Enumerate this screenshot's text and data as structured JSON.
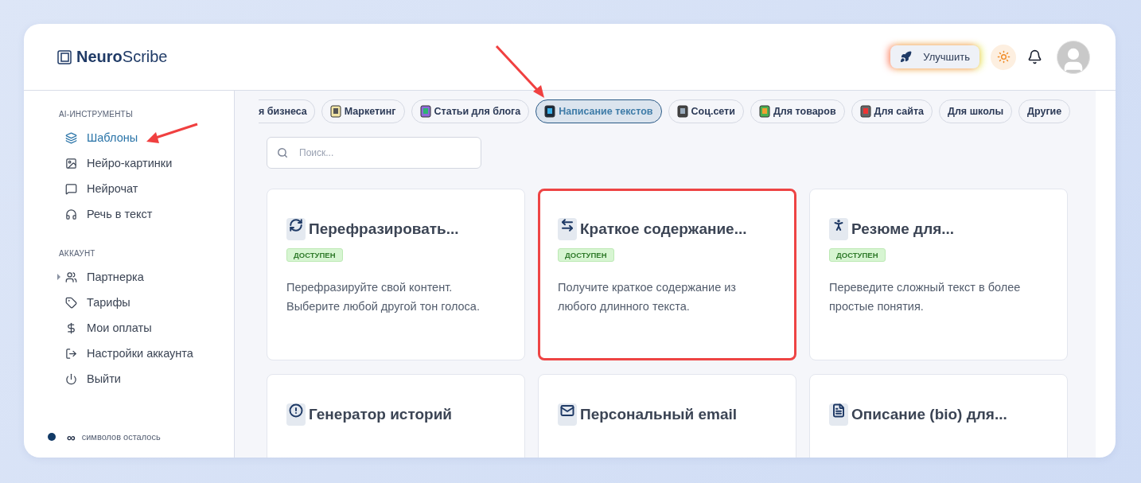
{
  "logo": {
    "text": "**Neuro**Scribe"
  },
  "header": {
    "upgrade_button": "Улучшить"
  },
  "sidebar": {
    "sections": [
      {
        "title": "AI-ИНСТРУМЕНТЫ",
        "items": [
          {
            "label": "Шаблоны",
            "selected": true
          },
          {
            "label": "Нейро-картинки",
            "selected": false
          },
          {
            "label": "Нейрочат",
            "selected": false
          },
          {
            "label": "Речь в текст",
            "selected": false
          }
        ]
      },
      {
        "title": "АККАУНТ",
        "items": [
          {
            "label": "Партнерка",
            "selected": false,
            "expanded": false
          },
          {
            "label": "Тарифы",
            "selected": false
          },
          {
            "label": "Мои оплаты",
            "selected": false
          },
          {
            "label": "Настройки аккаунта",
            "selected": false
          },
          {
            "label": "Выйти",
            "selected": false
          }
        ]
      }
    ],
    "footer": {
      "infinity": "∞",
      "label": "символов осталось"
    }
  },
  "categories": [
    {
      "label": "я бизнеса",
      "selected": false,
      "clipped": true
    },
    {
      "label": "Маркетинг",
      "selected": false
    },
    {
      "label": "Статьи для блога",
      "selected": false
    },
    {
      "label": "Написание текстов",
      "selected": true
    },
    {
      "label": "Соц.сети",
      "selected": false
    },
    {
      "label": "Для товаров",
      "selected": false
    },
    {
      "label": "Для сайта",
      "selected": false
    },
    {
      "label": "Для школы",
      "selected": false
    },
    {
      "label": "Другие",
      "selected": false
    }
  ],
  "search": {
    "placeholder": "Поиск..."
  },
  "cards": [
    {
      "title": "Перефразировать...",
      "badge": "ДОСТУПЕН",
      "description": "Перефразируйте свой контент. Выберите любой другой тон голоса.",
      "highlighted": false
    },
    {
      "title": "Краткое содержание...",
      "badge": "ДОСТУПЕН",
      "description": "Получите краткое содержание из любого длинного текста.",
      "highlighted": true
    },
    {
      "title": "Резюме для...",
      "badge": "ДОСТУПЕН",
      "description": "Переведите сложный текст в более простые понятия.",
      "highlighted": false
    },
    {
      "title": "Генератор историй",
      "highlighted": false
    },
    {
      "title": "Персональный email",
      "highlighted": false
    },
    {
      "title": "Описание (bio) для...",
      "highlighted": false
    }
  ]
}
